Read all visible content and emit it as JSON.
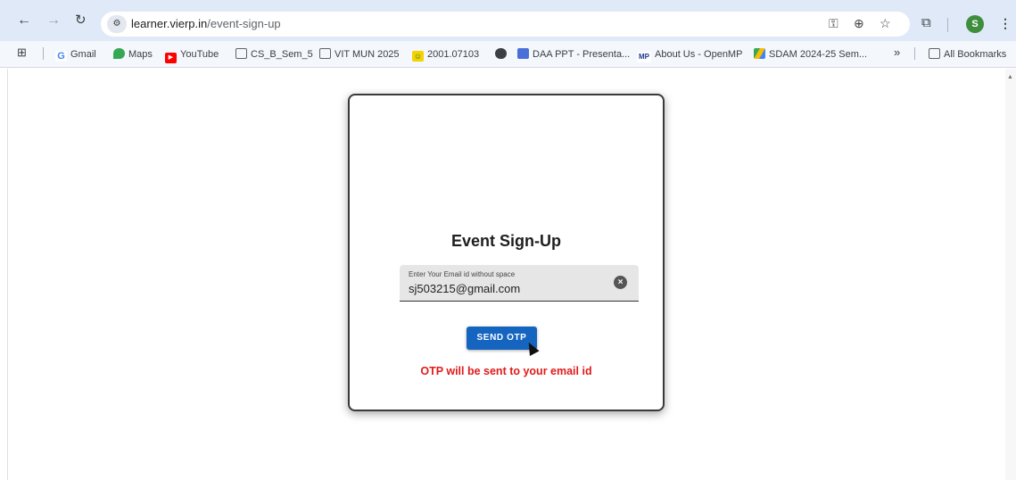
{
  "browser": {
    "url_host": "learner.vierp.in",
    "url_path": "/event-sign-up",
    "profile_initial": "S",
    "colors": {
      "chrome": "#dfe9f7",
      "profile": "#3e8e3e"
    }
  },
  "bookmarks": {
    "items": [
      {
        "label": "Gmail",
        "icon": "google-icon"
      },
      {
        "label": "Maps",
        "icon": "maps-pin-icon"
      },
      {
        "label": "YouTube",
        "icon": "youtube-icon"
      },
      {
        "label": "CS_B_Sem_5",
        "icon": "folder-icon"
      },
      {
        "label": "VIT MUN 2025",
        "icon": "folder-icon"
      },
      {
        "label": "2001.07103",
        "icon": "smiley-icon"
      },
      {
        "label": "",
        "icon": "globe-icon"
      },
      {
        "label": "DAA PPT - Presenta...",
        "icon": "slides-icon"
      },
      {
        "label": "About Us - OpenMP",
        "icon": "openmp-icon"
      },
      {
        "label": "SDAM 2024-25 Sem...",
        "icon": "drive-icon"
      }
    ],
    "overflow": "»",
    "all_bookmarks": "All Bookmarks"
  },
  "form": {
    "title": "Event Sign-Up",
    "email_label": "Enter Your Email id without space",
    "email_value": "sj503215@gmail.com",
    "send_button": "SEND OTP",
    "note": "OTP will be sent to your email id",
    "colors": {
      "button": "#1565c0",
      "note": "#e01b1b"
    }
  }
}
